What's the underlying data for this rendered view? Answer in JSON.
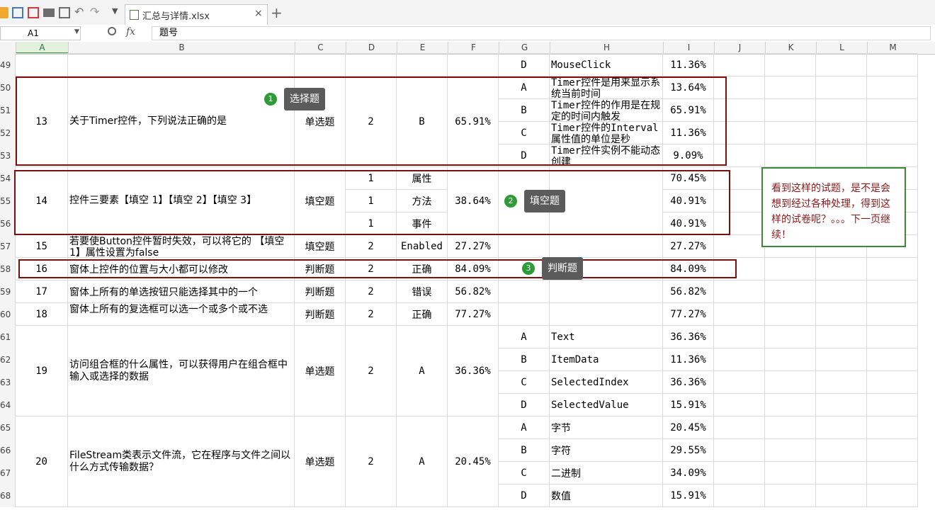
{
  "toolbar": {
    "icons": [
      "open-folder-icon",
      "save-icon",
      "pdf-icon",
      "print-icon",
      "print-preview-icon",
      "undo-icon",
      "redo-icon",
      "customize-arrow-icon"
    ],
    "file_tab": "汇总与详情.xlsx",
    "close_glyph": "×",
    "new_tab_glyph": "+"
  },
  "formula_bar": {
    "name_box": "A1",
    "fx": "fx",
    "formula": "题号"
  },
  "columns": [
    "A",
    "B",
    "C",
    "D",
    "E",
    "F",
    "G",
    "H",
    "I",
    "J",
    "K",
    "L",
    "M"
  ],
  "row_numbers": [
    "49",
    "50",
    "51",
    "52",
    "53",
    "54",
    "55",
    "56",
    "57",
    "58",
    "59",
    "60",
    "61",
    "62",
    "63",
    "64",
    "65",
    "66",
    "67",
    "68"
  ],
  "cells": [
    {
      "t": "D"
    },
    {
      "t": "MouseClick"
    },
    {
      "t": "11.36%"
    },
    {
      "t": "13"
    },
    {
      "t": "关于Timer控件，下列说法正确的是"
    },
    {
      "t": "单选题"
    },
    {
      "t": "2"
    },
    {
      "t": "B"
    },
    {
      "t": "65.91%"
    },
    {
      "t": "A"
    },
    {
      "t": "Timer控件是用来显示系统当前时间"
    },
    {
      "t": "13.64%"
    },
    {
      "t": "B"
    },
    {
      "t": "Timer控件的作用是在规定的时间内触发"
    },
    {
      "t": "65.91%"
    },
    {
      "t": "C"
    },
    {
      "t": "Timer控件的Interval属性值的单位是秒"
    },
    {
      "t": "11.36%"
    },
    {
      "t": "D"
    },
    {
      "t": "Timer控件实例不能动态创建"
    },
    {
      "t": "9.09%"
    },
    {
      "t": "14"
    },
    {
      "t": "控件三要素【填空 1】【填空 2】【填空 3】"
    },
    {
      "t": "填空题"
    },
    {
      "t": "1"
    },
    {
      "t": "属性"
    },
    {
      "t": "70.45%"
    },
    {
      "t": "38.64%"
    },
    {
      "t": "1"
    },
    {
      "t": "方法"
    },
    {
      "t": "40.91%"
    },
    {
      "t": "1"
    },
    {
      "t": "事件"
    },
    {
      "t": "40.91%"
    },
    {
      "t": "15"
    },
    {
      "t": "若要使Button控件暂时失效，可以将它的 【填空 1】属性设置为false"
    },
    {
      "t": "填空题"
    },
    {
      "t": "2"
    },
    {
      "t": "Enabled"
    },
    {
      "t": "27.27%"
    },
    {
      "t": "27.27%"
    },
    {
      "t": "16"
    },
    {
      "t": "窗体上控件的位置与大小都可以修改"
    },
    {
      "t": "判断题"
    },
    {
      "t": "2"
    },
    {
      "t": "正确"
    },
    {
      "t": "84.09%"
    },
    {
      "t": "84.09%"
    },
    {
      "t": "17"
    },
    {
      "t": "窗体上所有的单选按钮只能选择其中的一个"
    },
    {
      "t": "判断题"
    },
    {
      "t": "2"
    },
    {
      "t": "错误"
    },
    {
      "t": "56.82%"
    },
    {
      "t": "56.82%"
    },
    {
      "t": "18"
    },
    {
      "t": "窗体上所有的复选框可以选一个或多个或不选"
    },
    {
      "t": "判断题"
    },
    {
      "t": "2"
    },
    {
      "t": "正确"
    },
    {
      "t": "77.27%"
    },
    {
      "t": "77.27%"
    },
    {
      "t": "19"
    },
    {
      "t": "访问组合框的什么属性，可以获得用户在组合框中输入或选择的数据"
    },
    {
      "t": "单选题"
    },
    {
      "t": "2"
    },
    {
      "t": "A"
    },
    {
      "t": "36.36%"
    },
    {
      "t": "A"
    },
    {
      "t": "Text"
    },
    {
      "t": "36.36%"
    },
    {
      "t": "B"
    },
    {
      "t": "ItemData"
    },
    {
      "t": "11.36%"
    },
    {
      "t": "C"
    },
    {
      "t": "SelectedIndex"
    },
    {
      "t": "36.36%"
    },
    {
      "t": "D"
    },
    {
      "t": "SelectedValue"
    },
    {
      "t": "15.91%"
    },
    {
      "t": "20"
    },
    {
      "t": "FileStream类表示文件流，它在程序与文件之间以什么方式传输数据？"
    },
    {
      "t": "单选题"
    },
    {
      "t": "2"
    },
    {
      "t": "A"
    },
    {
      "t": "20.45%"
    },
    {
      "t": "A"
    },
    {
      "t": "字节"
    },
    {
      "t": "20.45%"
    },
    {
      "t": "B"
    },
    {
      "t": "字符"
    },
    {
      "t": "29.55%"
    },
    {
      "t": "C"
    },
    {
      "t": "二进制"
    },
    {
      "t": "34.09%"
    },
    {
      "t": "D"
    },
    {
      "t": "数值"
    },
    {
      "t": "15.91%"
    }
  ],
  "callouts": [
    {
      "num": "1",
      "label": "选择题"
    },
    {
      "num": "2",
      "label": "填空题"
    },
    {
      "num": "3",
      "label": "判断题"
    }
  ],
  "note": "看到这样的试题，是不是会想到经过各种处理，得到这样的试卷呢？。。。下一页继续！",
  "colors": {
    "highlight_box": "#7b1010",
    "note_border": "#3c8a38",
    "note_text": "#8b1a1a",
    "badge": "#2e9a38",
    "callout_bg": "#5b5b5b"
  }
}
